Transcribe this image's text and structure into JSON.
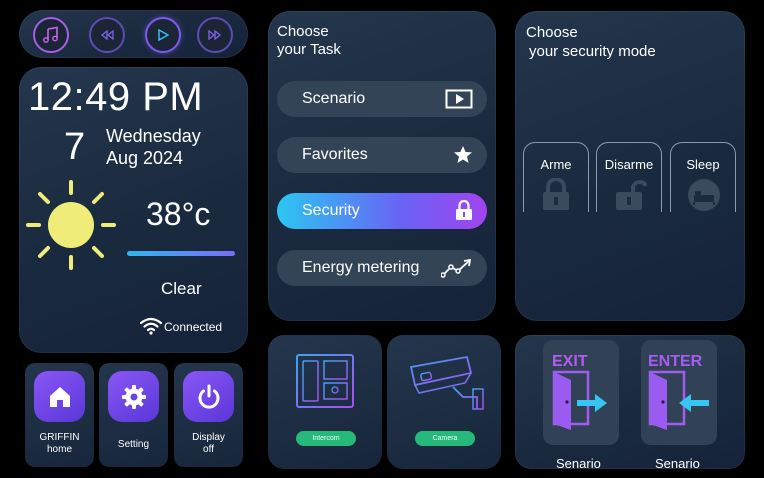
{
  "media_controls": {
    "buttons": [
      {
        "icon": "music-note-icon",
        "color": "#c567f0"
      },
      {
        "icon": "rewind-icon",
        "color": "#7d63e6"
      },
      {
        "icon": "play-icon",
        "color": "#2fbff2"
      },
      {
        "icon": "fast-forward-icon",
        "color": "#7d63e6"
      }
    ]
  },
  "clock": {
    "time": "12:49 PM",
    "day_number": "7",
    "weekday": "Wednesday",
    "month_year": "Aug 2024"
  },
  "weather": {
    "temperature": "38°c",
    "condition": "Clear",
    "sun_color": "#f0ec7a"
  },
  "connection": {
    "status": "Connected"
  },
  "apps": [
    {
      "label_line1": "GRIFFIN",
      "label_line2": "home",
      "icon": "home-icon"
    },
    {
      "label_line1": "Setting",
      "label_line2": "",
      "icon": "gear-icon"
    },
    {
      "label_line1": "Display",
      "label_line2": "off",
      "icon": "power-icon"
    }
  ],
  "task_panel": {
    "heading_line1": "Choose",
    "heading_line2": "your Task",
    "tasks": [
      {
        "label": "Scenario",
        "icon": "play-screen-icon",
        "active": false
      },
      {
        "label": "Favorites",
        "icon": "star-icon",
        "active": false
      },
      {
        "label": "Security",
        "icon": "lock-icon",
        "active": true
      },
      {
        "label": "Energy metering",
        "icon": "trend-chart-icon",
        "active": false
      }
    ]
  },
  "security_panel": {
    "heading_line1": "Choose",
    "heading_line2": "your security mode",
    "modes": [
      {
        "label": "Arme",
        "icon": "locked-icon"
      },
      {
        "label": "Disarme",
        "icon": "unlocked-icon"
      },
      {
        "label": "Sleep",
        "icon": "sleep-bed-icon"
      }
    ]
  },
  "devices": {
    "intercom_label": "Intercom",
    "camera_label": "Camera"
  },
  "scenarios": [
    {
      "sign": "EXIT",
      "label": "Senario",
      "sign_color": "#b45cf0"
    },
    {
      "sign": "ENTER",
      "label": "Senario",
      "sign_color": "#a65cf2"
    }
  ]
}
